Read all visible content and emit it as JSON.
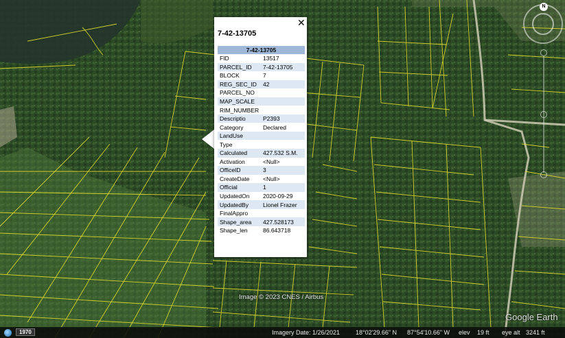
{
  "popup": {
    "title": "7-42-13705",
    "header": "7-42-13705",
    "close_glyph": "✕",
    "rows": [
      {
        "key": "FID",
        "value": "13517"
      },
      {
        "key": "PARCEL_ID",
        "value": "7-42-13705"
      },
      {
        "key": "BLOCK",
        "value": "7"
      },
      {
        "key": "REG_SEC_ID",
        "value": "42"
      },
      {
        "key": "PARCEL_NO",
        "value": ""
      },
      {
        "key": "MAP_SCALE",
        "value": ""
      },
      {
        "key": "RIM_NUMBER",
        "value": ""
      },
      {
        "key": "Descriptio",
        "value": "P2393"
      },
      {
        "key": "Category",
        "value": "Declared"
      },
      {
        "key": "LandUse",
        "value": ""
      },
      {
        "key": "Type",
        "value": ""
      },
      {
        "key": "Calculated",
        "value": "427.532 S.M."
      },
      {
        "key": "Activation",
        "value": "<Null>"
      },
      {
        "key": "OfficeID",
        "value": "3"
      },
      {
        "key": "CreateDate",
        "value": "<Null>"
      },
      {
        "key": "Official",
        "value": "1"
      },
      {
        "key": "UpdatedOn",
        "value": "2020-09-29"
      },
      {
        "key": "UpdatedBy",
        "value": "Lionel Frazer"
      },
      {
        "key": "FinalAppro",
        "value": ""
      },
      {
        "key": "Shape_area",
        "value": "427.528173"
      },
      {
        "key": "Shape_len",
        "value": "86.643718"
      }
    ]
  },
  "map": {
    "image_credit": "Image © 2023 CNES / Airbus",
    "logo": "Google Earth",
    "compass_label": "N",
    "parcel_line_color": "#e3e02a",
    "imagery_colors": {
      "forest": "#2a4a24",
      "water": "#24372c",
      "road": "#c9c7b4"
    }
  },
  "status_bar": {
    "history_year": "1970",
    "imagery_date": "Imagery Date: 1/26/2021",
    "latitude": "18°02'29.66\" N",
    "longitude": "87°54'10.66\" W",
    "elev_label": "elev",
    "elev_value": "19 ft",
    "eye_alt_label": "eye alt",
    "eye_alt_value": "3241 ft"
  },
  "icons": [
    "globe-icon",
    "close-icon",
    "compass-icon"
  ]
}
